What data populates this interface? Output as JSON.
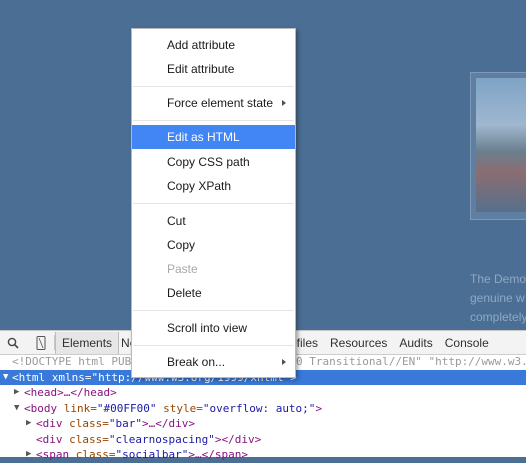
{
  "page": {
    "promo_lines": [
      "The Demo",
      "genuine w",
      "completely"
    ]
  },
  "devtools": {
    "tabs": [
      "Elements",
      "Ne",
      "ofiles",
      "Resources",
      "Audits",
      "Console"
    ],
    "dom": {
      "doctype": "<!DOCTYPE html PUB",
      "doctype_tail": "0 Transitional//EN\" \"http://www.w3.",
      "html_line": "<html xmlns=\"http://www.w3.org/1999/xhtml\">",
      "head_line": "<head>…</head>",
      "body_tag": "<body",
      "body_attr1": " link=",
      "body_val1": "\"#00FF00\"",
      "body_attr2": " style=",
      "body_val2": "\"overflow: auto;\"",
      "body_close": ">",
      "div_bar_open": "<div",
      "div_bar_attr": " class=",
      "div_bar_val": "\"bar\"",
      "div_bar_close": ">…</div>",
      "div_clear_open": "<div",
      "div_clear_attr": " class=",
      "div_clear_val": "\"clearnospacing\"",
      "div_clear_close": "></div>",
      "span_open": "<span",
      "span_attr": " class=",
      "span_val": "\"socialbar\"",
      "span_close": ">…</span>"
    }
  },
  "context_menu": {
    "add_attribute": "Add attribute",
    "edit_attribute": "Edit attribute",
    "force_element_state": "Force element state",
    "edit_as_html": "Edit as HTML",
    "copy_css_path": "Copy CSS path",
    "copy_xpath": "Copy XPath",
    "cut": "Cut",
    "copy": "Copy",
    "paste": "Paste",
    "delete": "Delete",
    "scroll_into_view": "Scroll into view",
    "break_on": "Break on..."
  },
  "colors": {
    "page_bg": "#4b6f94",
    "menu_highlight": "#4285f4",
    "selected_row": "#3879d9"
  }
}
